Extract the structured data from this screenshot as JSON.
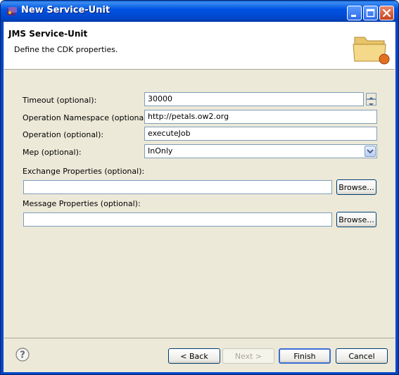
{
  "window": {
    "title": "New Service-Unit"
  },
  "banner": {
    "title": "JMS Service-Unit",
    "description": "Define the CDK properties."
  },
  "form": {
    "timeout_label": "Timeout (optional):",
    "timeout_value": "30000",
    "namespace_label": "Operation Namespace (optional):",
    "namespace_value": "http://petals.ow2.org",
    "operation_label": "Operation (optional):",
    "operation_value": "executeJob",
    "mep_label": "Mep (optional):",
    "mep_value": "InOnly",
    "exchange_label": "Exchange Properties (optional):",
    "exchange_value": "",
    "exchange_browse": "Browse...",
    "message_label": "Message Properties (optional):",
    "message_value": "",
    "message_browse": "Browse..."
  },
  "footer": {
    "back": "< Back",
    "next": "Next >",
    "finish": "Finish",
    "cancel": "Cancel"
  },
  "colors": {
    "titlebar": "#0054e3",
    "dialog_bg": "#ece9d8",
    "field_border": "#7f9db9"
  },
  "icons": {
    "app": "eclipse-app-icon",
    "minimize": "minimize-icon",
    "maximize": "maximize-icon",
    "close": "close-icon",
    "banner": "folder-icon",
    "help": "help-icon"
  }
}
